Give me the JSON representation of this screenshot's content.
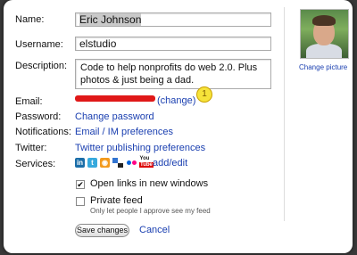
{
  "form": {
    "name_label": "Name:",
    "name_value": "Eric Johnson",
    "username_label": "Username:",
    "username_value": "elstudio",
    "description_label": "Description:",
    "description_value": "Code to help nonprofits do web 2.0. Plus photos & just being a dad.",
    "email_label": "Email:",
    "email_change": "(change)",
    "badge": "1",
    "password_label": "Password:",
    "password_link": "Change password",
    "notifications_label": "Notifications:",
    "notifications_link": "Email / IM preferences",
    "twitter_label": "Twitter:",
    "twitter_link": "Twitter publishing preferences",
    "services_label": "Services:",
    "services_addedit": "add/edit",
    "service_icons": [
      "linkedin-icon",
      "twitter-icon",
      "rss-icon",
      "delicious-icon",
      "flickr-icon",
      "youtube-icon"
    ],
    "open_links_label": "Open links in new windows",
    "open_links_checked": true,
    "private_feed_label": "Private feed",
    "private_feed_checked": false,
    "private_feed_note": "Only let people I approve see my feed",
    "save_label": "Save changes",
    "cancel_label": "Cancel"
  },
  "sidebar": {
    "change_picture": "Change picture"
  },
  "colors": {
    "link": "#1a3fb0",
    "redaction": "#e01818",
    "badge": "#f6e33a"
  }
}
